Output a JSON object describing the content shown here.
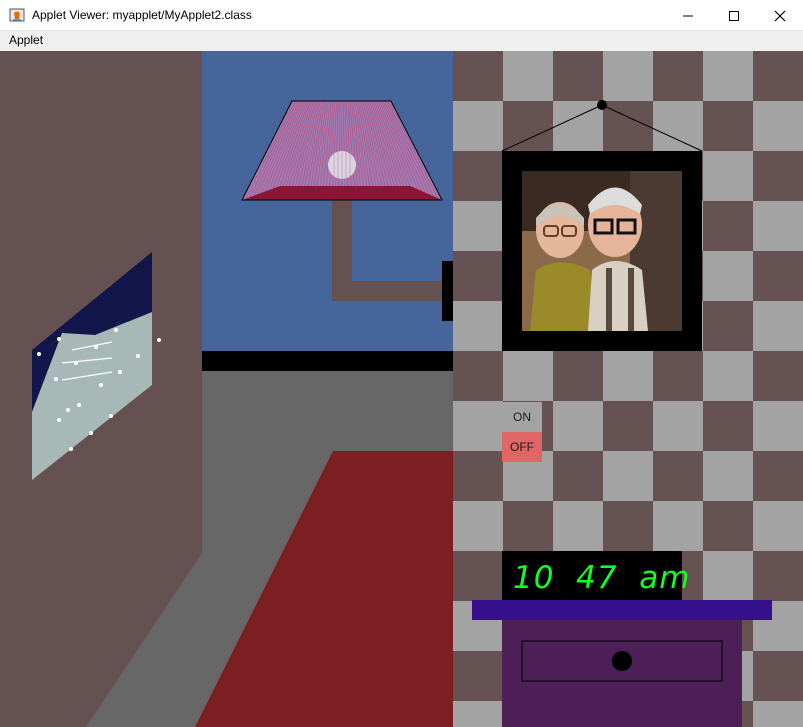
{
  "window": {
    "title": "Applet Viewer: myapplet/MyApplet2.class",
    "app_icon": "java-cup-icon",
    "controls": [
      "minimize-icon",
      "maximize-icon",
      "close-icon"
    ]
  },
  "menu": {
    "applet_label": "Applet"
  },
  "scene": {
    "switch": {
      "on_label": "ON",
      "off_label": "OFF",
      "state": "OFF"
    },
    "clock": {
      "hour": "10",
      "minute": "47",
      "period": "am",
      "display": "10  47  am"
    },
    "colors": {
      "wall": "#655151",
      "blue_wall": "#46659b",
      "floor_gray": "#676767",
      "rug": "#7c1e22",
      "checker_light": "#a3a3a3",
      "checker_dark": "#665252",
      "window_glass": "#a7b9b7",
      "window_night": "#12164a",
      "nightstand": "#4c1f57",
      "nightstand_top": "#34108c",
      "clock_digits": "#12ff1f",
      "switch_on_bg": "#a3a3a3",
      "switch_off_bg": "#e06666"
    }
  }
}
